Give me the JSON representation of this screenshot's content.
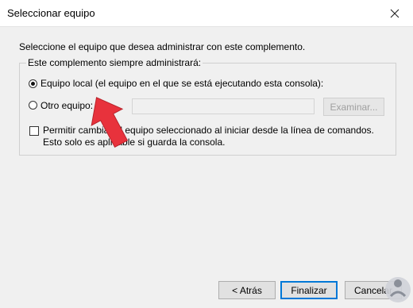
{
  "window": {
    "title": "Seleccionar equipo"
  },
  "intro_text": "Seleccione el equipo que desea administrar con este complemento.",
  "group": {
    "legend": "Este complemento siempre administrará:",
    "local_option": "Equipo local (el equipo en el que se está ejecutando esta consola):",
    "other_option": "Otro equipo:",
    "other_input_value": "",
    "browse_label": "Examinar...",
    "allow_change_text": "Permitir cambiar el equipo seleccionado al iniciar desde la línea de comandos. Esto solo es aplicable si guarda la consola."
  },
  "state": {
    "selected_option": "local",
    "allow_change_checked": false
  },
  "buttons": {
    "back": "< Atrás",
    "finish": "Finalizar",
    "cancel": "Cancelar"
  },
  "icons": {
    "close": "close-icon",
    "annotation": "red-arrow-icon",
    "logo": "watermark-logo-icon"
  },
  "colors": {
    "accent": "#0078d7",
    "arrow": "#e8323c"
  }
}
